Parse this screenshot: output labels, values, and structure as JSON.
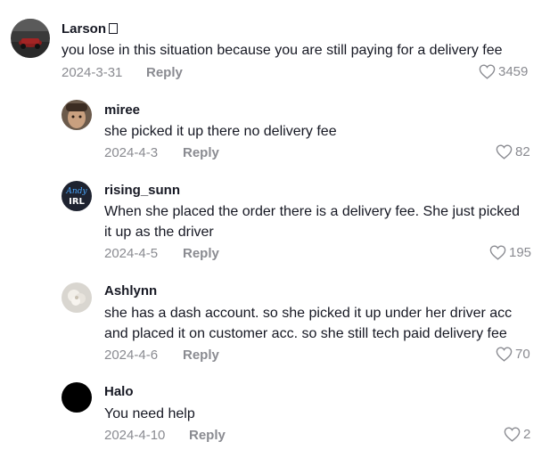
{
  "comments": [
    {
      "username": "Larson",
      "text_lines": [
        "you lose in this situation because you are still paying for a delivery fee"
      ],
      "date": "2024-3-31",
      "reply_label": "Reply",
      "likes": "3459"
    },
    {
      "username": "miree",
      "text_lines": [
        "she picked it up there no delivery fee"
      ],
      "date": "2024-4-3",
      "reply_label": "Reply",
      "likes": "82"
    },
    {
      "username": "rising_sunn",
      "text_lines": [
        "When she placed the order there is a delivery fee. She just picked",
        "it up as the driver"
      ],
      "date": "2024-4-5",
      "reply_label": "Reply",
      "likes": "195",
      "avatar_text": [
        "Andy",
        "IRL"
      ]
    },
    {
      "username": "Ashlynn",
      "text_lines": [
        "she has a dash account. so she picked it up under her driver acc",
        "and placed it on customer acc. so she still tech paid delivery fee"
      ],
      "date": "2024-4-6",
      "reply_label": "Reply",
      "likes": "70"
    },
    {
      "username": "Halo",
      "text_lines": [
        "You need help"
      ],
      "date": "2024-4-10",
      "reply_label": "Reply",
      "likes": "2"
    }
  ]
}
